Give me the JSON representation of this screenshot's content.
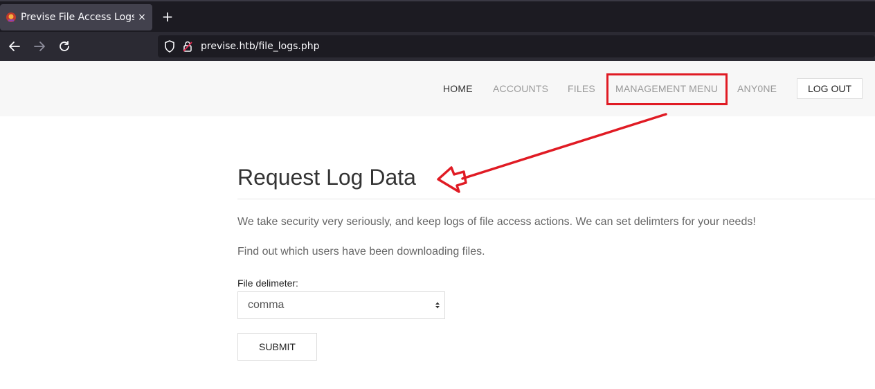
{
  "browser": {
    "tab_title": "Previse File Access Logs",
    "tab_close": "×",
    "new_tab": "+",
    "url": "previse.htb/file_logs.php"
  },
  "header": {
    "menu": [
      {
        "label": "HOME",
        "active": true
      },
      {
        "label": "ACCOUNTS",
        "active": false
      },
      {
        "label": "FILES",
        "active": false
      },
      {
        "label": "MANAGEMENT MENU",
        "active": false
      },
      {
        "label": "ANY0NE",
        "active": false
      }
    ],
    "logout_label": "LOG OUT"
  },
  "main": {
    "title": "Request Log Data",
    "paragraph_1": "We take security very seriously, and keep logs of file access actions. We can set delimters for your needs!",
    "paragraph_2": "Find out which users have been downloading files.",
    "delimiter_label": "File delimeter:",
    "delimiter_selected": "comma",
    "submit_label": "SUBMIT"
  },
  "colors": {
    "annotation_red": "#e01b24",
    "chrome_dark": "#1c1b22",
    "header_bg": "#f7f7f7"
  }
}
